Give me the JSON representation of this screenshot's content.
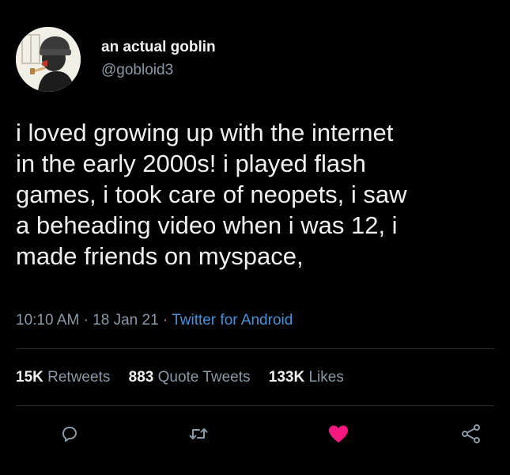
{
  "user": {
    "display_name": "an actual goblin",
    "handle": "@gobloid3",
    "avatar_icon": "goblin-avatar-icon"
  },
  "tweet": {
    "lines": [
      "i loved growing up with the internet",
      "in the early 2000s! i played flash",
      "games, i took care of neopets, i saw",
      "a beheading video when i was 12, i",
      "made friends on myspace,"
    ],
    "time": "10:10 AM",
    "date": "18 Jan 21",
    "separator": "·",
    "source": "Twitter for Android"
  },
  "stats": {
    "retweets_count": "15K",
    "retweets_label": "Retweets",
    "quotes_count": "883",
    "quotes_label": "Quote Tweets",
    "likes_count": "133K",
    "likes_label": "Likes"
  },
  "actions": {
    "reply_icon": "reply-icon",
    "retweet_icon": "retweet-icon",
    "like_icon": "heart-icon",
    "share_icon": "share-icon"
  },
  "colors": {
    "background": "#000000",
    "text": "#f0f0f0",
    "muted": "#8b98a5",
    "link": "#4a90d9",
    "like": "#f91880",
    "divider": "#2a2d30"
  }
}
